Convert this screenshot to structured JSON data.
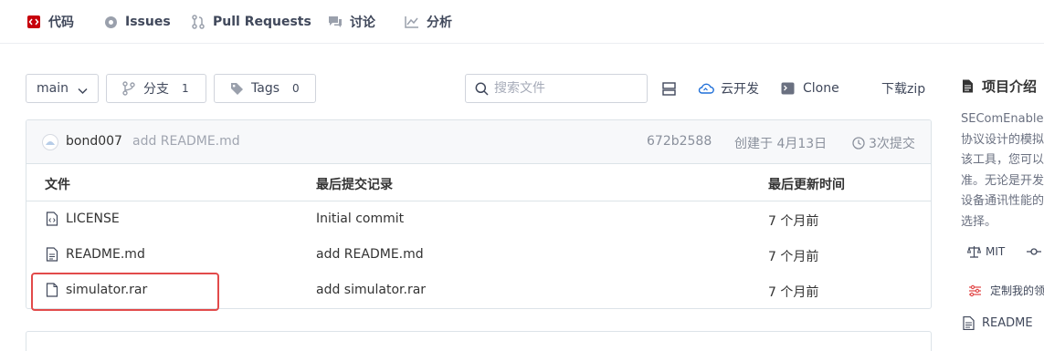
{
  "nav": {
    "items": [
      {
        "label": "代码",
        "icon": "code-icon"
      },
      {
        "label": "Issues",
        "icon": "issues-icon"
      },
      {
        "label": "Pull Requests",
        "icon": "pull-request-icon"
      },
      {
        "label": "讨论",
        "icon": "discussion-icon"
      },
      {
        "label": "分析",
        "icon": "analytics-icon"
      }
    ]
  },
  "toolbar": {
    "branch": "main",
    "branches_label": "分支",
    "branches_count": "1",
    "tags_label": "Tags",
    "tags_count": "0",
    "search_placeholder": "搜索文件",
    "cloud_dev_label": "云开发",
    "clone_label": "Clone",
    "download_label": "下载zip"
  },
  "commit": {
    "author": "bond007",
    "message": "add README.md",
    "hash": "672b2588",
    "created": "创建于 4月13日",
    "commits": "3次提交"
  },
  "table": {
    "headers": {
      "file": "文件",
      "commit": "最后提交记录",
      "updated": "最后更新时间"
    },
    "rows": [
      {
        "name": "LICENSE",
        "commit": "Initial commit",
        "updated": "7 个月前"
      },
      {
        "name": "README.md",
        "commit": "add README.md",
        "updated": "7 个月前"
      },
      {
        "name": "simulator.rar",
        "commit": "add simulator.rar",
        "updated": "7 个月前"
      }
    ]
  },
  "sidebar": {
    "title": "项目介绍",
    "desc_lines": [
      "SEComEnable",
      "协议设计的模拟",
      "该工具，您可以",
      "准。无论是开发",
      "设备通讯性能的",
      "选择。"
    ],
    "license": "MIT",
    "customize": "定制我的领",
    "readme": "README"
  },
  "colors": {
    "accent_red": "#e24a4a",
    "brand_red": "#c7000b",
    "text": "#333333",
    "muted": "#8a909c"
  }
}
